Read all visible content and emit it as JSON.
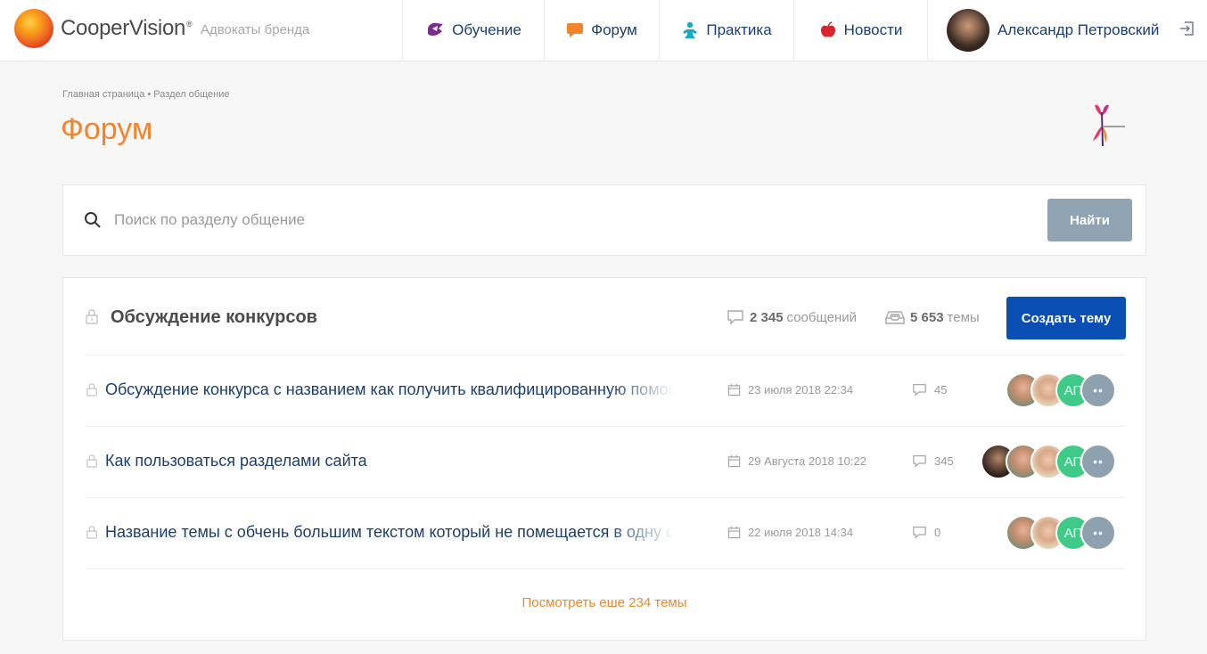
{
  "header": {
    "brand": "CooperVision",
    "brand_mark": "®",
    "subtitle": "Адвокаты бренда",
    "nav": [
      {
        "label": "Обучение",
        "icon": "graduation-icon",
        "color": "#7a2e8c"
      },
      {
        "label": "Форум",
        "icon": "chat-bubble-icon",
        "color": "#f0852c"
      },
      {
        "label": "Практика",
        "icon": "person-icon",
        "color": "#1aa9c4"
      },
      {
        "label": "Новости",
        "icon": "apple-icon",
        "color": "#d9262e"
      }
    ],
    "user_name": "Александр Петровский"
  },
  "page": {
    "breadcrumb": "Главная страница • Раздел общение",
    "title": "Форум"
  },
  "search": {
    "placeholder": "Поиск по разделу общение",
    "button_label": "Найти"
  },
  "section": {
    "title": "Обсуждение конкурсов",
    "messages_count": "2 345",
    "messages_label": "сообщений",
    "topics_count": "5 653",
    "topics_label": "темы",
    "create_button": "Создать тему",
    "topics": [
      {
        "title": "Обсуждение конкурса с названием как получить квалифицированную помощь",
        "date": "23 июля 2018 22:34",
        "replies": "45",
        "initials": "АП"
      },
      {
        "title": "Как пользоваться разделами сайта",
        "date": "29 Августа 2018 10:22",
        "replies": "345",
        "initials": "АП"
      },
      {
        "title": "Название темы с обчень большим текстом который не помещается в одну строку",
        "date": "22 июля 2018 14:34",
        "replies": "0",
        "initials": "АП"
      }
    ],
    "more_link": "Посмотреть еше 234 темы"
  },
  "colors": {
    "accent": "#f0852c",
    "primary_button": "#0a50b4",
    "search_button": "#8fa3b2",
    "link": "#1c3f6e",
    "online_avatar": "#3fca87"
  }
}
